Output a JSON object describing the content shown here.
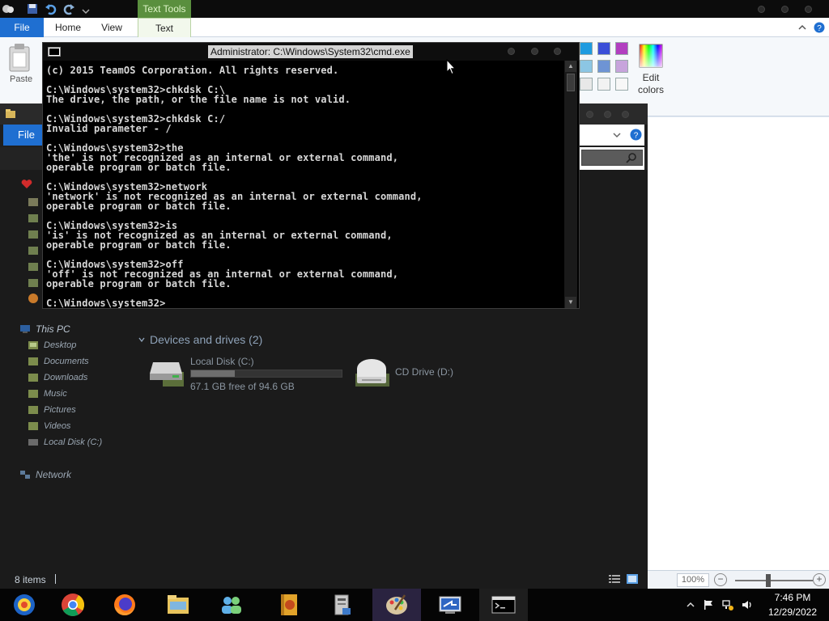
{
  "paint": {
    "contextual_tab": "Text Tools",
    "tabs": [
      "File",
      "Home",
      "View",
      "Text"
    ],
    "paste_label": "Paste",
    "edit_colors_line1": "Edit",
    "edit_colors_line2": "colors",
    "zoom_level": "100%",
    "zoom_out_symbol": "−",
    "zoom_in_symbol": "+"
  },
  "explorer": {
    "file_tab": "File",
    "sidebar": {
      "this_pc": "This PC",
      "items": [
        "Desktop",
        "Documents",
        "Downloads",
        "Music",
        "Pictures",
        "Videos",
        "Local Disk (C:)"
      ],
      "network": "Network"
    },
    "section_header": "Devices and drives (2)",
    "drives": [
      {
        "name": "Local Disk (C:)",
        "free_text": "67.1 GB free of 94.6 GB",
        "used_fraction": 0.29,
        "icon": "hard-drive-icon"
      },
      {
        "name": "CD Drive (D:)",
        "icon": "cd-drive-icon"
      }
    ],
    "status": {
      "items_count": "8 items"
    }
  },
  "cmd": {
    "title": "Administrator: C:\\Windows\\System32\\cmd.exe",
    "lines": [
      "(c) 2015 TeamOS Corporation. All rights reserved.",
      "",
      "C:\\Windows\\system32>chkdsk C:\\",
      "The drive, the path, or the file name is not valid.",
      "",
      "C:\\Windows\\system32>chkdsk C:/",
      "Invalid parameter - /",
      "",
      "C:\\Windows\\system32>the",
      "'the' is not recognized as an internal or external command,",
      "operable program or batch file.",
      "",
      "C:\\Windows\\system32>network",
      "'network' is not recognized as an internal or external command,",
      "operable program or batch file.",
      "",
      "C:\\Windows\\system32>is",
      "'is' is not recognized as an internal or external command,",
      "operable program or batch file.",
      "",
      "C:\\Windows\\system32>off",
      "'off' is not recognized as an internal or external command,",
      "operable program or batch file.",
      "",
      "C:\\Windows\\system32>"
    ]
  },
  "taskbar": {
    "apps": [
      {
        "name": "internet-explorer",
        "icon": "internet-explorer-icon"
      },
      {
        "name": "chrome",
        "icon": "chrome-icon"
      },
      {
        "name": "firefox",
        "icon": "firefox-icon"
      },
      {
        "name": "file-explorer",
        "icon": "folder-icon"
      },
      {
        "name": "people",
        "icon": "people-icon"
      },
      {
        "name": "book",
        "icon": "book-icon"
      },
      {
        "name": "installer",
        "icon": "installer-icon"
      },
      {
        "name": "paint",
        "icon": "palette-icon"
      },
      {
        "name": "remote-desktop",
        "icon": "remote-desktop-icon"
      },
      {
        "name": "command-prompt",
        "icon": "cmd-icon"
      }
    ],
    "clock": {
      "time": "7:46 PM",
      "date": "12/29/2022"
    }
  },
  "colors": {
    "palette": [
      "#1e9be0",
      "#3a4fd8",
      "#b23fc0",
      "#8cc6e4",
      "#6e94d4",
      "#c7a4dc",
      "#e8e8e8",
      "#f2f2f2",
      "#f7f7f7"
    ],
    "accent": "#1f6fd1",
    "text_tools_tab": "#5a8f3e"
  }
}
